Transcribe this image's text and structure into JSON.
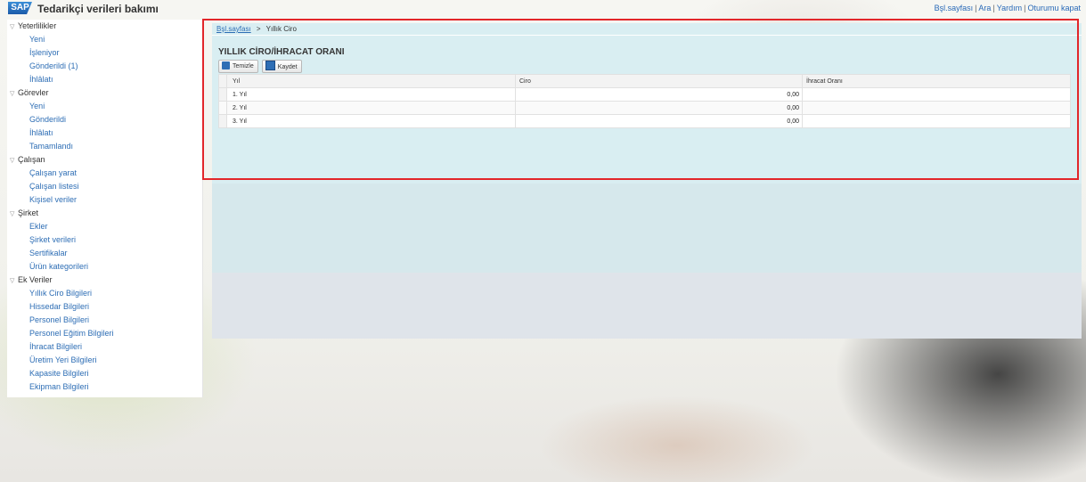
{
  "app": {
    "logo": "SAP",
    "title": "Tedarikçi verileri bakımı"
  },
  "top_links": [
    "Bşl.sayfası",
    "Ara",
    "Yardım",
    "Oturumu kapat"
  ],
  "sidebar": {
    "groups": [
      {
        "label": "Yeterlilikler",
        "items": [
          "Yeni",
          "İşleniyor",
          "Gönderildi (1)",
          "İhlâlatı"
        ]
      },
      {
        "label": "Görevler",
        "items": [
          "Yeni",
          "Gönderildi",
          "İhlâlatı",
          "Tamamlandı"
        ]
      },
      {
        "label": "Çalışan",
        "items": [
          "Çalışan yarat",
          "Çalışan listesi",
          "Kişisel veriler"
        ]
      },
      {
        "label": "Şirket",
        "items": [
          "Ekler",
          "Şirket verileri",
          "Sertifikalar",
          "Ürün kategorileri"
        ]
      },
      {
        "label": "Ek Veriler",
        "items": [
          "Yıllık Ciro Bilgileri",
          "Hissedar Bilgileri",
          "Personel Bilgileri",
          "Personel Eğitim Bilgileri",
          "İhracat Bilgileri",
          "Üretim Yeri Bilgileri",
          "Kapasite Bilgileri",
          "Ekipman Bilgileri"
        ]
      }
    ]
  },
  "main": {
    "breadcrumb": {
      "home": "Bşl.sayfası",
      "separator": ">",
      "current": "Yıllık Ciro"
    },
    "title": "YILLIK CİRO/İHRACAT ORANI",
    "toolbar": {
      "clear_label": "Temizle",
      "save_label": "Kaydet"
    },
    "table": {
      "headers": [
        "Yıl",
        "Ciro",
        "İhracat Oranı"
      ],
      "rows": [
        [
          "1. Yıl",
          "0,00",
          ""
        ],
        [
          "2. Yıl",
          "0,00",
          ""
        ],
        [
          "3. Yıl",
          "0,00",
          ""
        ]
      ]
    }
  },
  "colors": {
    "accent": "#2e6eb5",
    "highlight": "#e2262a",
    "panel": "#d9eef2"
  }
}
